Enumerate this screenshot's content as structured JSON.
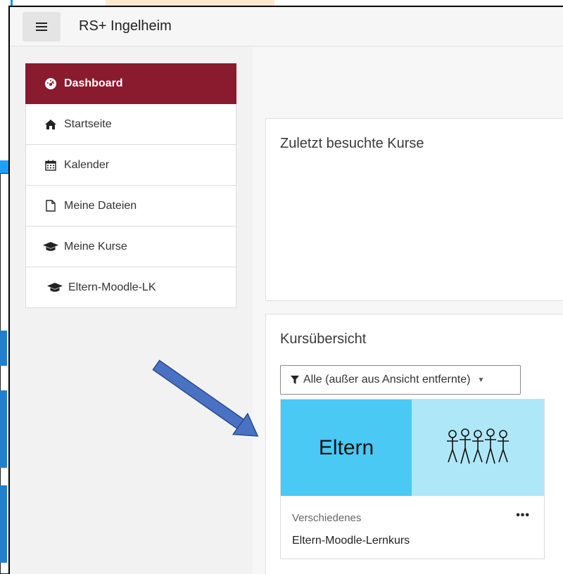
{
  "site": {
    "name": "RS+ Ingelheim"
  },
  "sidebar": {
    "items": [
      {
        "label": "Dashboard",
        "icon": "dashboard-icon",
        "active": true
      },
      {
        "label": "Startseite",
        "icon": "home-icon"
      },
      {
        "label": "Kalender",
        "icon": "calendar-icon"
      },
      {
        "label": "Meine Dateien",
        "icon": "file-icon"
      },
      {
        "label": "Meine Kurse",
        "icon": "graduation-cap-icon"
      },
      {
        "label": "Eltern-Moodle-LK",
        "icon": "graduation-cap-icon"
      }
    ]
  },
  "recent": {
    "title": "Zuletzt besuchte Kurse"
  },
  "overview": {
    "title": "Kursübersicht",
    "filter_label": "Alle (außer aus Ansicht entfernte)",
    "course": {
      "image_text": "Eltern",
      "category": "Verschiedenes",
      "name": "Eltern-Moodle-Lernkurs",
      "more": "•••"
    }
  },
  "colors": {
    "active_nav": "#8a1b2e",
    "course_image_left": "#4ac9f5",
    "course_image_right": "#aee7f8",
    "arrow": "#4a72c4"
  }
}
